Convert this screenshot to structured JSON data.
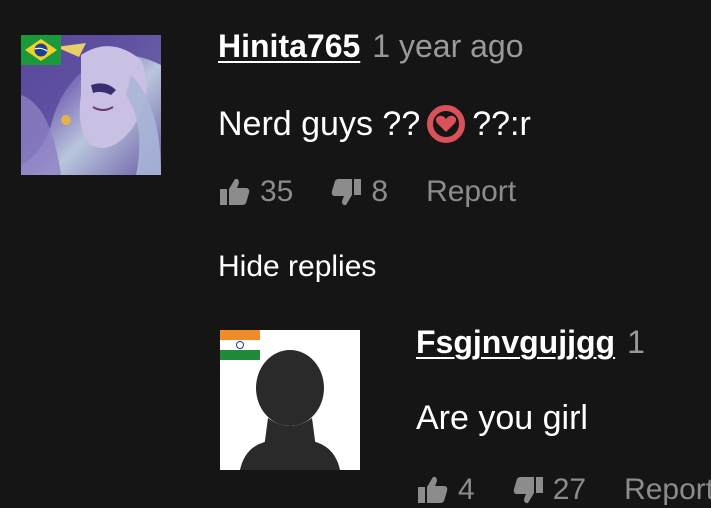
{
  "comment": {
    "username": "Hinita765",
    "time": "1 year ago",
    "text_before": "Nerd guys ??",
    "text_after": "??:r",
    "likes": "35",
    "dislikes": "8",
    "report": "Report",
    "hide_replies": "Hide replies"
  },
  "reply": {
    "username": "Fsgjnvgujjgg",
    "time": "1",
    "text": "Are you girl",
    "likes": "4",
    "dislikes": "27",
    "report": "Report"
  },
  "icons": {
    "like": "thumbs-up-icon",
    "dislike": "thumbs-down-icon",
    "emoji": "heart-ring-emoji-icon"
  },
  "colors": {
    "background": "#151515",
    "username": "#ffffff",
    "muted": "#8c8c8c",
    "emoji": "#d9525a"
  }
}
